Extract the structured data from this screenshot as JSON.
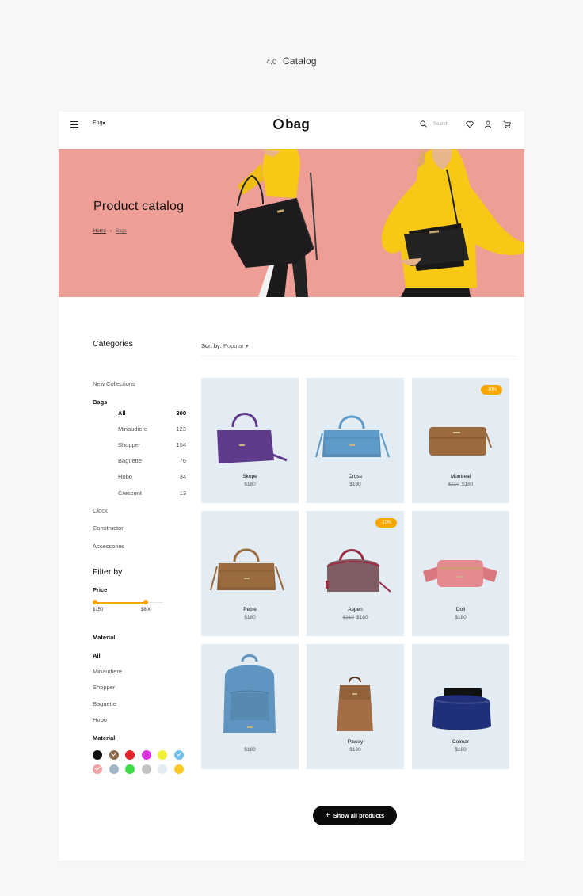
{
  "caption": {
    "number": "4.0",
    "title": "Catalog"
  },
  "header": {
    "lang": "Eng",
    "logo_o": "O",
    "logo_text": "bag",
    "search_placeholder": "Search"
  },
  "hero": {
    "title": "Product catalog",
    "breadcrumb": {
      "home": "Home",
      "separator": "›",
      "current": "Bags"
    }
  },
  "categories": {
    "title": "Categories",
    "items": [
      {
        "label": "New Collections"
      },
      {
        "label": "Bags"
      },
      {
        "label": "Clock"
      },
      {
        "label": "Constructor"
      },
      {
        "label": "Accessories"
      }
    ],
    "bags_sub": [
      {
        "label": "All",
        "count": "300"
      },
      {
        "label": "Minaudiere",
        "count": "123"
      },
      {
        "label": "Shopper",
        "count": "154"
      },
      {
        "label": "Baguette",
        "count": "76"
      },
      {
        "label": "Hobo",
        "count": "34"
      },
      {
        "label": "Crescent",
        "count": "13"
      }
    ]
  },
  "sort": {
    "label": "Sort by:",
    "value": "Popular"
  },
  "filter": {
    "title": "Filter by",
    "price": {
      "label": "Price",
      "min": "$150",
      "max": "$800"
    },
    "material": {
      "title": "Material",
      "items": [
        "All",
        "Minaudiere",
        "Shopper",
        "Baguette",
        "Hobo"
      ]
    },
    "material2": {
      "title": "Material",
      "swatches": [
        {
          "color": "#111111",
          "checked": false
        },
        {
          "color": "#8c6a4b",
          "checked": true
        },
        {
          "color": "#e0262a",
          "checked": false
        },
        {
          "color": "#e033e6",
          "checked": false
        },
        {
          "color": "#f0f23a",
          "checked": false
        },
        {
          "color": "#6ec0ec",
          "checked": true
        },
        {
          "color": "#f0a4a6",
          "checked": true
        },
        {
          "color": "#9fb6c7",
          "checked": false
        },
        {
          "color": "#3fdc49",
          "checked": false
        },
        {
          "color": "#c2c2c2",
          "checked": false
        },
        {
          "color": "#e3ecf3",
          "checked": false
        },
        {
          "color": "#fbc928",
          "checked": false
        }
      ]
    }
  },
  "products": [
    {
      "name": "Skope",
      "price": "$180",
      "old_price": "",
      "badge": "",
      "bag_color": "#5e3a8a",
      "shape": "tote"
    },
    {
      "name": "Cross",
      "price": "$180",
      "old_price": "",
      "badge": "",
      "bag_color": "#5f9bc9",
      "shape": "cross"
    },
    {
      "name": "Montreal",
      "price": "$180",
      "old_price": "$210",
      "badge": "-10%",
      "bag_color": "#9b6a3f",
      "shape": "clutch"
    },
    {
      "name": "Peble",
      "price": "$180",
      "old_price": "",
      "badge": "",
      "bag_color": "#9a6b3e",
      "shape": "cross"
    },
    {
      "name": "Aspen",
      "price": "$180",
      "old_price": "$210",
      "badge": "-10%",
      "bag_color": "#7e5e63",
      "shape": "dome"
    },
    {
      "name": "Doll",
      "price": "$180",
      "old_price": "",
      "badge": "",
      "bag_color": "#e68a92",
      "shape": "belt"
    },
    {
      "name": "",
      "price": "$180",
      "old_price": "",
      "badge": "",
      "bag_color": "#5f95c0",
      "shape": "backpack"
    },
    {
      "name": "Paway",
      "price": "$180",
      "old_price": "",
      "badge": "",
      "bag_color": "#a36e45",
      "shape": "smallpack"
    },
    {
      "name": "Colmar",
      "price": "$180",
      "old_price": "",
      "badge": "",
      "bag_color": "#1f2f7a",
      "shape": "fur"
    }
  ],
  "show_all": {
    "icon": "+",
    "label": "Show all products"
  }
}
